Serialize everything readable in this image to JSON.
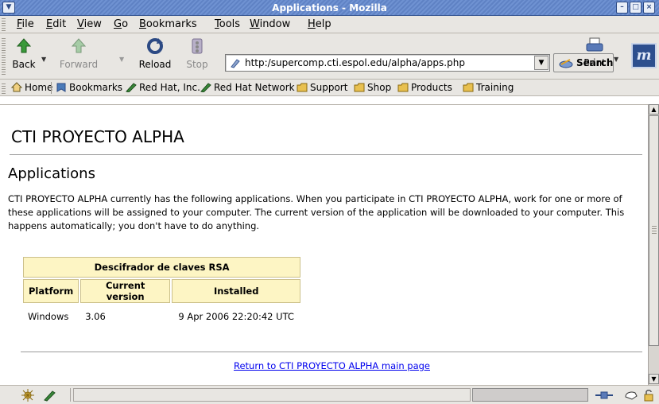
{
  "window": {
    "title": "Applications - Mozilla"
  },
  "menubar": {
    "items": [
      {
        "label": "File",
        "key": "F"
      },
      {
        "label": "Edit",
        "key": "E"
      },
      {
        "label": "View",
        "key": "V"
      },
      {
        "label": "Go",
        "key": "G"
      },
      {
        "label": "Bookmarks",
        "key": "B"
      },
      {
        "label": "Tools",
        "key": "T"
      },
      {
        "label": "Window",
        "key": "W"
      },
      {
        "label": "Help",
        "key": "H"
      }
    ]
  },
  "navbar": {
    "back_label": "Back",
    "forward_label": "Forward",
    "reload_label": "Reload",
    "stop_label": "Stop",
    "url": "http:/supercomp.cti.espol.edu/alpha/apps.php",
    "search_label": "Search",
    "print_label": "Print"
  },
  "personal_toolbar": {
    "items": [
      {
        "label": "Home",
        "icon": "home-icon"
      },
      {
        "label": "Bookmarks",
        "icon": "bookmarks-icon"
      },
      {
        "label": "Red Hat, Inc.",
        "icon": "bookmark-link-icon"
      },
      {
        "label": "Red Hat Network",
        "icon": "bookmark-link-icon"
      },
      {
        "label": "Support",
        "icon": "folder-icon"
      },
      {
        "label": "Shop",
        "icon": "folder-icon"
      },
      {
        "label": "Products",
        "icon": "folder-icon"
      },
      {
        "label": "Training",
        "icon": "folder-icon"
      }
    ]
  },
  "page": {
    "site_title": "CTI PROYECTO ALPHA",
    "heading": "Applications",
    "intro": "CTI PROYECTO ALPHA currently has the following applications. When you participate in CTI PROYECTO ALPHA, work for one or more of these applications will be assigned to your computer. The current version of the application will be downloaded to your computer. This happens automatically; you don't have to do anything.",
    "app_table": {
      "app_name": "Descifrador de claves RSA",
      "headers": [
        "Platform",
        "Current version",
        "Installed"
      ],
      "rows": [
        [
          "Windows",
          "3.06",
          "9 Apr 2006 22:20:42 UTC"
        ]
      ]
    },
    "return_link": "Return to CTI PROYECTO ALPHA main page"
  },
  "statusbar": {
    "text": "",
    "progress": 0
  },
  "colors": {
    "titlebar": "#5f82c4",
    "table_header_bg": "#fdf5c4",
    "link": "#0000ee"
  }
}
